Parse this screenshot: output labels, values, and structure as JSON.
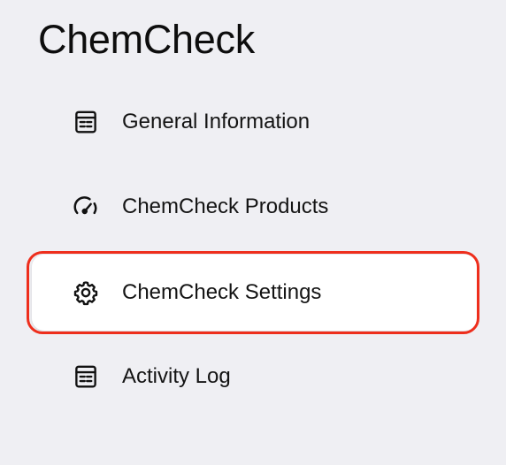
{
  "app": {
    "title": "ChemCheck"
  },
  "nav": {
    "items": [
      {
        "label": "General Information",
        "icon": "document-list-icon",
        "active": false
      },
      {
        "label": "ChemCheck Products",
        "icon": "speedometer-icon",
        "active": false
      },
      {
        "label": "ChemCheck Settings",
        "icon": "gear-icon",
        "active": true
      },
      {
        "label": "Activity Log",
        "icon": "document-list-icon",
        "active": false
      }
    ]
  },
  "colors": {
    "background": "#efeff3",
    "active_background": "#ffffff",
    "highlight_border": "#ee2e1c",
    "text": "#141414"
  }
}
